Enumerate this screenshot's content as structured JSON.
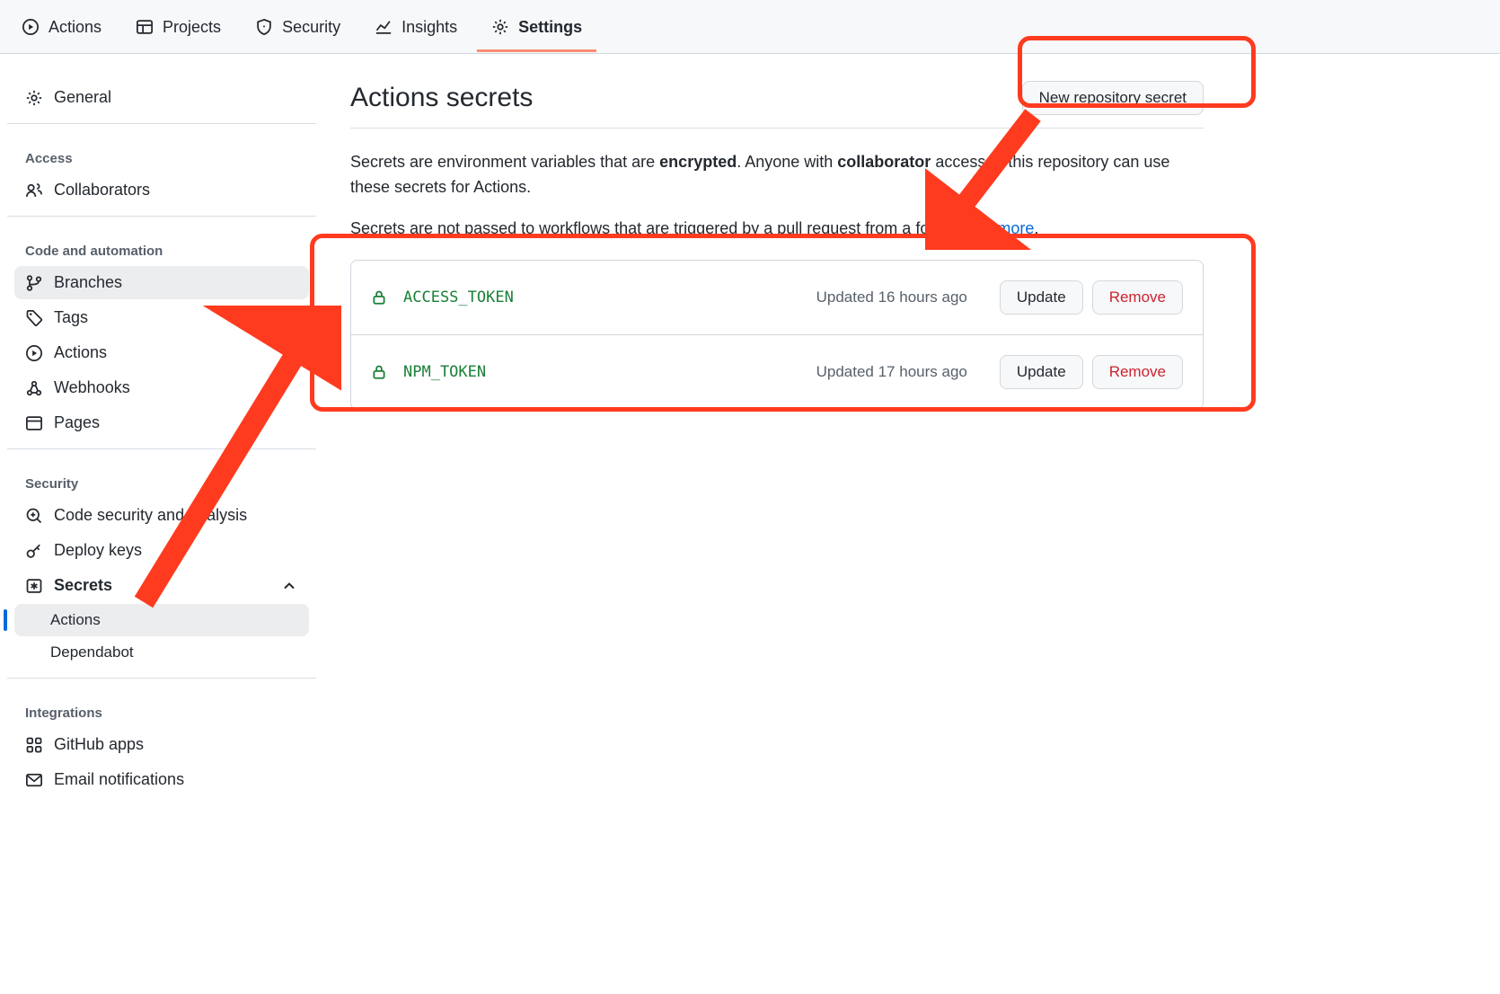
{
  "topnav": {
    "items": [
      {
        "label": "Actions"
      },
      {
        "label": "Projects"
      },
      {
        "label": "Security"
      },
      {
        "label": "Insights"
      },
      {
        "label": "Settings"
      }
    ]
  },
  "sidebar": {
    "general": "General",
    "sections": {
      "access": "Access",
      "code": "Code and automation",
      "security": "Security",
      "integrations": "Integrations"
    },
    "items": {
      "collaborators": "Collaborators",
      "branches": "Branches",
      "tags": "Tags",
      "actions": "Actions",
      "webhooks": "Webhooks",
      "pages": "Pages",
      "codesec": "Code security and analysis",
      "deploykeys": "Deploy keys",
      "secrets": "Secrets",
      "secrets_actions": "Actions",
      "secrets_dependabot": "Dependabot",
      "ghapps": "GitHub apps",
      "email": "Email notifications"
    }
  },
  "page": {
    "title": "Actions secrets",
    "new_secret_btn": "New repository secret",
    "desc1_a": "Secrets are environment variables that are ",
    "desc1_b": "encrypted",
    "desc1_c": ". Anyone with ",
    "desc1_d": "collaborator",
    "desc1_e": " access to this repository can use these secrets for Actions.",
    "desc2_a": "Secrets are not passed to workflows that are triggered by a pull request from a fork. ",
    "desc2_link": "Learn more",
    "desc2_b": "."
  },
  "secrets": [
    {
      "name": "ACCESS_TOKEN",
      "updated": "Updated 16 hours ago",
      "update": "Update",
      "remove": "Remove"
    },
    {
      "name": "NPM_TOKEN",
      "updated": "Updated 17 hours ago",
      "update": "Update",
      "remove": "Remove"
    }
  ]
}
